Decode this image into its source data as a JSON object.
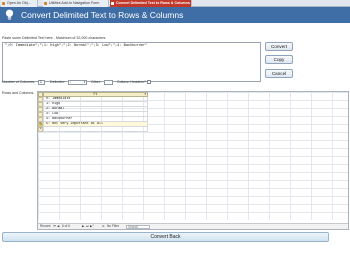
{
  "tabs": [
    {
      "label": "Open An Obj...",
      "active": false
    },
    {
      "label": "Utilities Add-In Navigation Form",
      "active": false
    },
    {
      "label": "Convert Delimited Text to Rows & Columns",
      "active": true
    }
  ],
  "header": {
    "title": "Convert Delimited Text to Rows & Columns",
    "icon": "lightbulb-icon",
    "color": "#3f6ea6"
  },
  "source": {
    "label": "Paste some Delimited Text here - Maximum of 32,000 characters:",
    "value": "\";0: Immediate\";\";1: High\";\";2: Normal\";\";3: Low\";\";4: Backburner\""
  },
  "buttons": {
    "convert": "Convert",
    "copy": "Copy",
    "cancel": "Cancel",
    "convert_back": "Convert Back"
  },
  "options": {
    "columns_label": "Number of Columns:",
    "columns_value": "1",
    "delimiter_label": "Delimiter:",
    "delimiter_value": ";",
    "other_label": "Other:",
    "other_value": "",
    "headers_label": "Column Headers?"
  },
  "grid": {
    "label": "Rows and Columns:",
    "column_header": "F1",
    "rows": [
      {
        "value": "0: Immediate",
        "marker": ""
      },
      {
        "value": "1: High",
        "marker": ""
      },
      {
        "value": "2: Normal",
        "marker": ""
      },
      {
        "value": "3: Low",
        "marker": ""
      },
      {
        "value": "4: Backburner",
        "marker": ""
      },
      {
        "value": "5: Not Very Important at All",
        "marker": "✎"
      },
      {
        "value": "",
        "marker": "*"
      }
    ],
    "nav": {
      "record_label": "Record:",
      "position": "6 of 6",
      "filter": "No Filter",
      "search": "Search"
    }
  }
}
